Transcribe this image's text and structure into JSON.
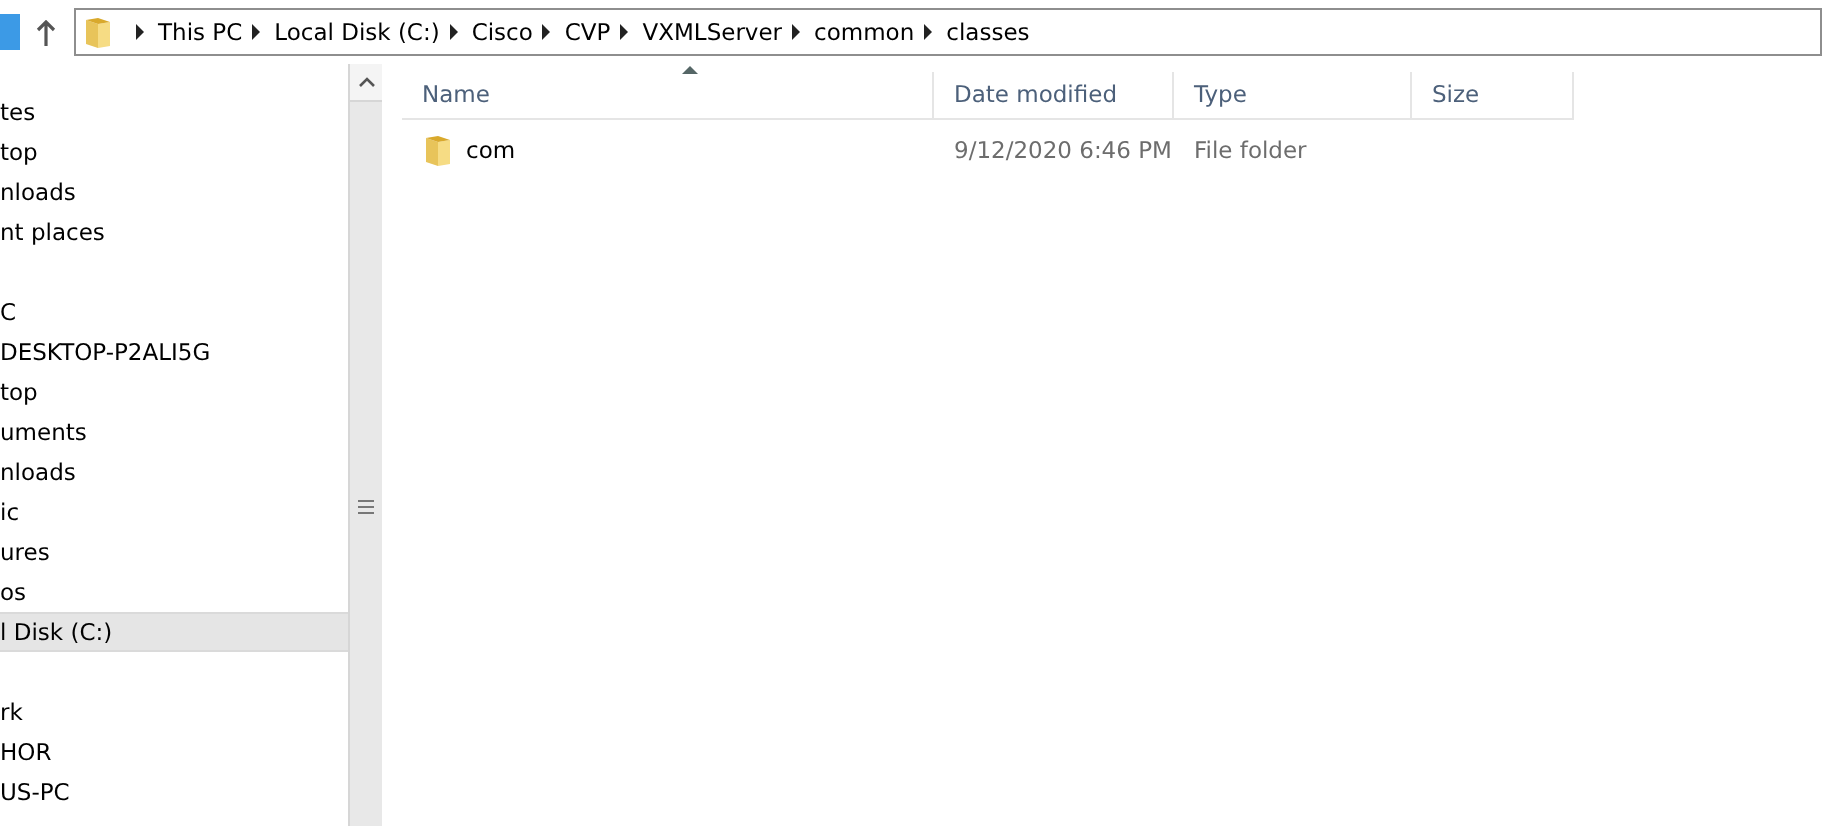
{
  "address_bar": {
    "crumbs": [
      "This PC",
      "Local Disk (C:)",
      "Cisco",
      "CVP",
      "VXMLServer",
      "common",
      "classes"
    ]
  },
  "sidebar": {
    "groups": [
      {
        "items": [
          {
            "label": "tes",
            "selected": false
          },
          {
            "label": "top",
            "selected": false
          },
          {
            "label": "nloads",
            "selected": false
          },
          {
            "label": "nt places",
            "selected": false
          }
        ]
      },
      {
        "items": [
          {
            "label": "C",
            "selected": false
          },
          {
            "label": "DESKTOP-P2ALI5G",
            "selected": false
          },
          {
            "label": "top",
            "selected": false
          },
          {
            "label": "uments",
            "selected": false
          },
          {
            "label": "nloads",
            "selected": false
          },
          {
            "label": "ic",
            "selected": false
          },
          {
            "label": "ures",
            "selected": false
          },
          {
            "label": "os",
            "selected": false
          },
          {
            "label": "l Disk (C:)",
            "selected": true
          }
        ]
      },
      {
        "items": [
          {
            "label": "rk",
            "selected": false
          },
          {
            "label": "HOR",
            "selected": false
          },
          {
            "label": "US-PC",
            "selected": false
          }
        ]
      }
    ]
  },
  "table": {
    "columns": [
      "Name",
      "Date modified",
      "Type",
      "Size"
    ],
    "rows": [
      {
        "name": "com",
        "date_modified": "9/12/2020 6:46 PM",
        "type": "File folder"
      }
    ]
  }
}
